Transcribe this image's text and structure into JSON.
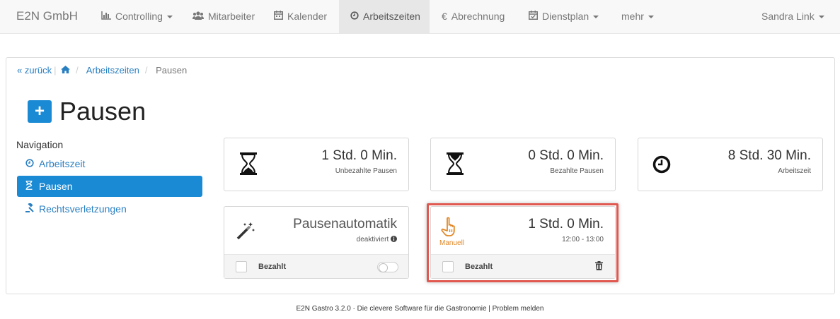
{
  "navbar": {
    "brand": "E2N GmbH",
    "items": [
      {
        "label": "Controlling",
        "icon": "bar-chart-icon",
        "dropdown": true
      },
      {
        "label": "Mitarbeiter",
        "icon": "users-icon",
        "dropdown": false
      },
      {
        "label": "Kalender",
        "icon": "calendar-icon",
        "dropdown": false
      },
      {
        "label": "Arbeitszeiten",
        "icon": "clock-icon",
        "dropdown": false,
        "active": true
      },
      {
        "label": "Abrechnung",
        "icon": "euro-icon",
        "dropdown": false
      },
      {
        "label": "Dienstplan",
        "icon": "calendar-check-icon",
        "dropdown": true
      },
      {
        "label": "mehr",
        "icon": "",
        "dropdown": true
      }
    ],
    "user": "Sandra Link"
  },
  "breadcrumb": {
    "back": "zurück",
    "home_icon": "home-icon",
    "section": "Arbeitszeiten",
    "current": "Pausen"
  },
  "page": {
    "title_icon": "plus-icon",
    "title": "Pausen"
  },
  "sidebar": {
    "heading": "Navigation",
    "items": [
      {
        "label": "Arbeitszeit",
        "icon": "clock-icon"
      },
      {
        "label": "Pausen",
        "icon": "hourglass-icon",
        "active": true
      },
      {
        "label": "Rechtsverletzungen",
        "icon": "gavel-icon"
      }
    ]
  },
  "stats": [
    {
      "value": "1 Std. 0 Min.",
      "label": "Unbezahlte Pausen",
      "icon": "hourglass-icon"
    },
    {
      "value": "0 Std. 0 Min.",
      "label": "Bezahlte Pausen",
      "icon": "hourglass-icon"
    },
    {
      "value": "8 Std. 30 Min.",
      "label": "Arbeitszeit",
      "icon": "clock-icon"
    }
  ],
  "automatik": {
    "title": "Pausenautomatik",
    "status": "deaktiviert",
    "info_icon": "info-icon",
    "icon": "magic-wand-icon",
    "checkbox_label": "Bezahlt",
    "toggle_on": false
  },
  "manual_break": {
    "value": "1 Std. 0 Min.",
    "time_range": "12:00 - 13:00",
    "type_label": "Manuell",
    "icon": "hand-pointer-icon",
    "checkbox_label": "Bezahlt",
    "delete_icon": "trash-icon"
  },
  "footer": {
    "text": "E2N Gastro 3.2.0 · Die clevere Software für die Gastronomie | Problem melden"
  },
  "colors": {
    "primary": "#1a8ad4",
    "link": "#2a7fc1",
    "highlight": "#e0584f",
    "manual": "#e0892a"
  }
}
